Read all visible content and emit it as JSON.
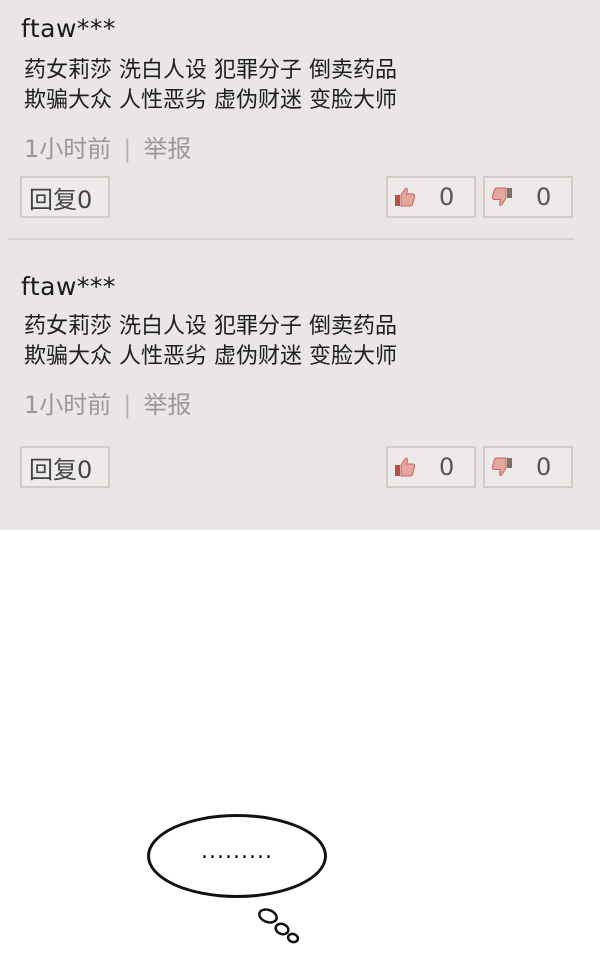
{
  "comments": [
    {
      "username": "ftaw***",
      "text_line_1": "药女莉莎 洗白人设 犯罪分子 倒卖药品",
      "text_line_2": "欺骗大众 人性恶劣 虚伪财迷 变脸大师",
      "time": "1小时前",
      "separator": "|",
      "report_label": "举报",
      "reply_label": "回复0",
      "likes": "0",
      "dislikes": "0"
    },
    {
      "username": "ftaw***",
      "text_line_1": "药女莉莎 洗白人设 犯罪分子 倒卖药品",
      "text_line_2": "欺骗大众 人性恶劣 虚伪财迷 变脸大师",
      "time": "1小时前",
      "separator": "|",
      "report_label": "举报",
      "reply_label": "回复0",
      "likes": "0",
      "dislikes": "0"
    }
  ],
  "speech_bubble": {
    "text": "........."
  },
  "icons": {
    "like": "thumbs-up-icon",
    "dislike": "thumbs-down-icon"
  },
  "colors": {
    "panel_background": "#e9e6e5",
    "thumb_icon": "#c8665f",
    "muted_text": "#9a9898"
  }
}
